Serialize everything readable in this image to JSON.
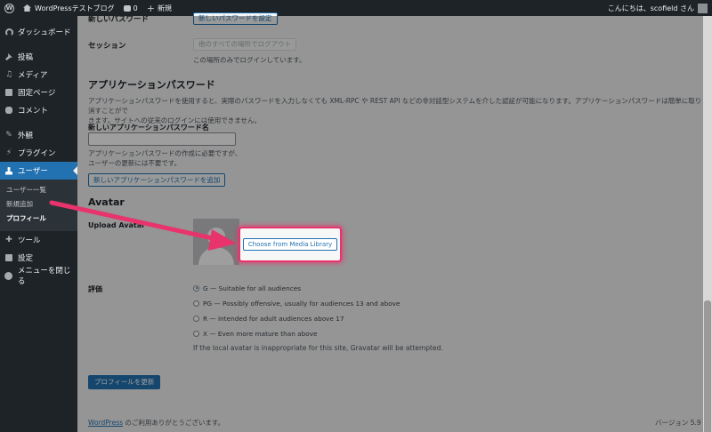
{
  "adminbar": {
    "site_name": "WordPressテストブログ",
    "comments_count": "0",
    "new_label": "新規",
    "greeting": "こんにちは、scofield さん"
  },
  "sidebar": {
    "dashboard": "ダッシュボード",
    "posts": "投稿",
    "media": "メディア",
    "pages": "固定ページ",
    "comments": "コメント",
    "appearance": "外観",
    "plugins": "プラグイン",
    "users": "ユーザー",
    "users_sub": [
      "ユーザー一覧",
      "新規追加",
      "プロフィール"
    ],
    "tools": "ツール",
    "settings": "設定",
    "collapse": "メニューを閉じる"
  },
  "profile": {
    "new_password_label": "新しいパスワード",
    "new_password_button": "新しいパスワードを設定",
    "session_label": "セッション",
    "logout_others_button": "他のすべての場所でログアウト",
    "session_desc": "この場所のみでログインしています。",
    "app_pw_heading": "アプリケーションパスワード",
    "app_pw_desc_1": "アプリケーションパスワードを使用すると、実際のパスワードを入力しなくても XML-RPC や REST API などの非対話型システムを介した認証が可能になります。アプリケーションパスワードは簡単に取り消すことがで",
    "app_pw_desc_2": "きます。サイトへの従来のログインには使用できません。",
    "app_pw_name_label": "新しいアプリケーションパスワード名",
    "app_pw_name_value": "",
    "app_pw_help_1": "アプリケーションパスワードの作成に必要ですが、",
    "app_pw_help_2": "ユーザーの更新には不要です。",
    "app_pw_add_button": "新しいアプリケーションパスワードを追加",
    "avatar_heading": "Avatar",
    "upload_avatar_label": "Upload Avatar",
    "choose_media_button": "Choose from Media Library",
    "rating_label": "評価",
    "ratings": [
      {
        "label": "G — Suitable for all audiences",
        "checked": true
      },
      {
        "label": "PG — Possibly offensive, usually for audiences 13 and above",
        "checked": false
      },
      {
        "label": "R — Intended for adult audiences above 17",
        "checked": false
      },
      {
        "label": "X — Even more mature than above",
        "checked": false
      }
    ],
    "rating_desc": "If the local avatar is inappropriate for this site, Gravatar will be attempted.",
    "update_button": "プロフィールを更新"
  },
  "footer": {
    "wp_link": "WordPress",
    "thanks": " のご利用ありがとうございます。",
    "version": "バージョン 5.9"
  },
  "colors": {
    "highlight": "#e8336d",
    "primary": "#2271b1"
  }
}
